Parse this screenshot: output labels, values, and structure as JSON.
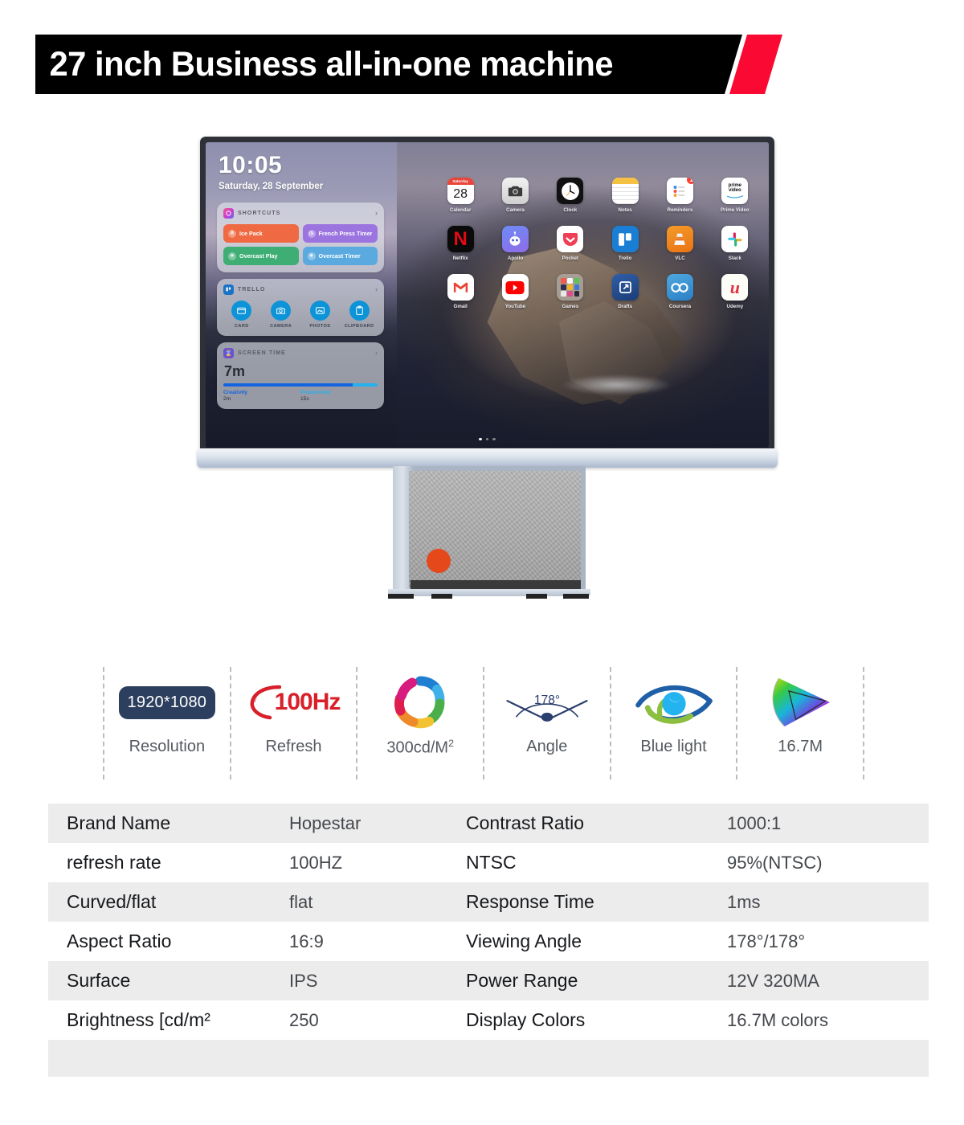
{
  "banner": {
    "title": "27 inch Business all-in-one machine",
    "black_color": "#000000",
    "accent_color": "#fa0a32"
  },
  "device": {
    "screen": {
      "clock": {
        "time": "10:05",
        "date": "Saturday, 28 September"
      },
      "widgets": [
        {
          "id": "shortcuts",
          "title": "SHORTCUTS",
          "chevron": "›",
          "tiles": [
            {
              "label": "Ice Pack",
              "icon": "ice-pack-icon",
              "color": "#ef6a43"
            },
            {
              "label": "French Press Timer",
              "icon": "clock-icon",
              "color": "#9b74e0"
            },
            {
              "label": "Overcast Play",
              "icon": "overcast-icon",
              "color": "#3eae74"
            },
            {
              "label": "Overcast Timer",
              "icon": "overcast-icon",
              "color": "#5aaae0"
            }
          ]
        },
        {
          "id": "trello",
          "title": "TRELLO",
          "chevron": "›",
          "actions": [
            {
              "label": "CARD",
              "icon": "card-icon"
            },
            {
              "label": "CAMERA",
              "icon": "camera-icon"
            },
            {
              "label": "PHOTOS",
              "icon": "photos-icon"
            },
            {
              "label": "CLIPBOARD",
              "icon": "clipboard-icon"
            }
          ]
        },
        {
          "id": "screen_time",
          "title": "SCREEN TIME",
          "chevron": "›",
          "total": "7m",
          "legend": [
            {
              "name": "Creativity",
              "value": "2m",
              "color": "#1464e0"
            },
            {
              "name": "Productivity",
              "value": "15s",
              "color": "#26b0ec"
            }
          ]
        }
      ],
      "apps": [
        {
          "label": "Calendar",
          "icon": "calendar-icon",
          "badge": ""
        },
        {
          "label": "Camera",
          "icon": "camera-icon",
          "badge": ""
        },
        {
          "label": "Clock",
          "icon": "clock-icon",
          "badge": ""
        },
        {
          "label": "Notes",
          "icon": "notes-icon",
          "badge": ""
        },
        {
          "label": "Reminders",
          "icon": "reminders-icon",
          "badge": "1"
        },
        {
          "label": "Prime Video",
          "icon": "prime-video-icon",
          "badge": ""
        },
        {
          "label": "Netflix",
          "icon": "netflix-icon",
          "badge": ""
        },
        {
          "label": "Apollo",
          "icon": "apollo-icon",
          "badge": ""
        },
        {
          "label": "Pocket",
          "icon": "pocket-icon",
          "badge": ""
        },
        {
          "label": "Trello",
          "icon": "trello-icon",
          "badge": ""
        },
        {
          "label": "VLC",
          "icon": "vlc-icon",
          "badge": ""
        },
        {
          "label": "Slack",
          "icon": "slack-icon",
          "badge": ""
        },
        {
          "label": "Gmail",
          "icon": "gmail-icon",
          "badge": ""
        },
        {
          "label": "YouTube",
          "icon": "youtube-icon",
          "badge": ""
        },
        {
          "label": "Games",
          "icon": "games-folder-icon",
          "badge": ""
        },
        {
          "label": "Drafts",
          "icon": "drafts-icon",
          "badge": ""
        },
        {
          "label": "Coursera",
          "icon": "coursera-icon",
          "badge": ""
        },
        {
          "label": "Udemy",
          "icon": "udemy-icon",
          "badge": ""
        }
      ],
      "calendar_icon": {
        "weekday": "Saturday",
        "day": "28"
      }
    }
  },
  "features": [
    {
      "id": "resolution",
      "icon": "resolution-chip-icon",
      "value": "1920*1080",
      "label": "Resolution"
    },
    {
      "id": "refresh",
      "icon": "refresh-swoosh-icon",
      "value": "100Hz",
      "label": "Refresh"
    },
    {
      "id": "brightness",
      "icon": "color-donut-icon",
      "value": "",
      "label": "300cd/M",
      "label_sup": "2"
    },
    {
      "id": "angle",
      "icon": "viewing-angle-icon",
      "value": "178°",
      "label": "Angle"
    },
    {
      "id": "bluelight",
      "icon": "eye-icon",
      "value": "",
      "label": "Blue light"
    },
    {
      "id": "colors",
      "icon": "color-gamut-icon",
      "value": "",
      "label": "16.7M"
    }
  ],
  "spec_table": {
    "rows": [
      {
        "key": "Brand Name",
        "value": "Hopestar",
        "key2": "Contrast Ratio",
        "value2": "1000:1"
      },
      {
        "key": "refresh rate",
        "value": "100HZ",
        "key2": "NTSC",
        "value2": "95%(NTSC)"
      },
      {
        "key": "Curved/flat",
        "value": "flat",
        "key2": "Response Time",
        "value2": "1ms"
      },
      {
        "key": "Aspect Ratio",
        "value": "16:9",
        "key2": "Viewing Angle",
        "value2": "178°/178°"
      },
      {
        "key": "Surface",
        "value": "IPS",
        "key2": "Power Range",
        "value2": "12V 320MA"
      },
      {
        "key": "Brightness [cd/m²",
        "value": "250",
        "key2": "Display Colors",
        "value2": "16.7M colors"
      }
    ]
  }
}
